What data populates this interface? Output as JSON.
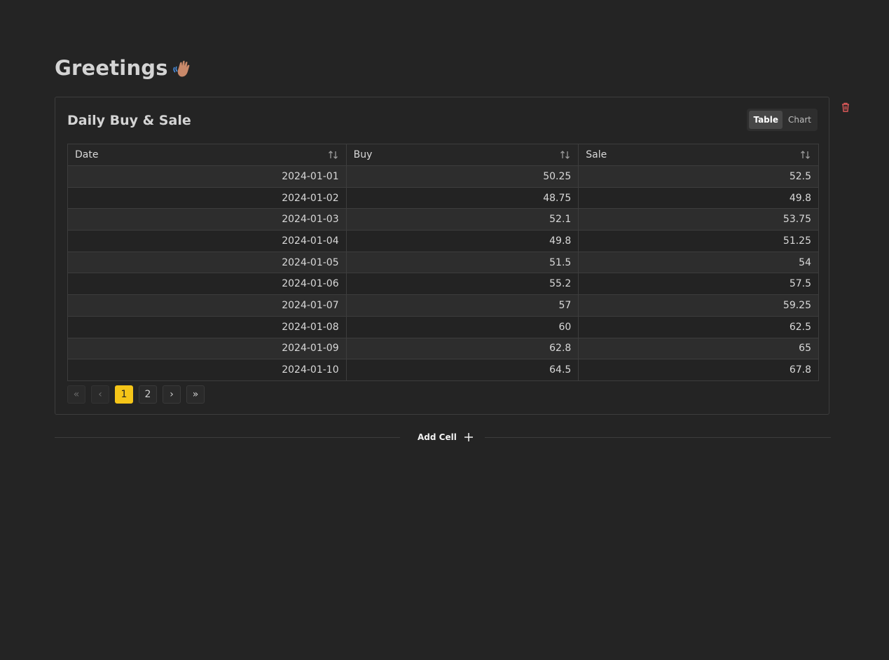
{
  "page": {
    "title": "Greetings"
  },
  "cell": {
    "title": "Daily Buy & Sale",
    "view_toggle": {
      "table_label": "Table",
      "chart_label": "Chart",
      "selected": "Table"
    },
    "table": {
      "columns": [
        "Date",
        "Buy",
        "Sale"
      ],
      "rows": [
        [
          "2024-01-01",
          "50.25",
          "52.5"
        ],
        [
          "2024-01-02",
          "48.75",
          "49.8"
        ],
        [
          "2024-01-03",
          "52.1",
          "53.75"
        ],
        [
          "2024-01-04",
          "49.8",
          "51.25"
        ],
        [
          "2024-01-05",
          "51.5",
          "54"
        ],
        [
          "2024-01-06",
          "55.2",
          "57.5"
        ],
        [
          "2024-01-07",
          "57",
          "59.25"
        ],
        [
          "2024-01-08",
          "60",
          "62.5"
        ],
        [
          "2024-01-09",
          "62.8",
          "65"
        ],
        [
          "2024-01-10",
          "64.5",
          "67.8"
        ]
      ]
    },
    "pagination": {
      "first": "«",
      "prev": "‹",
      "pages": [
        "1",
        "2"
      ],
      "current_page": "1",
      "next": "›",
      "last": "»"
    }
  },
  "add_cell": {
    "label": "Add Cell"
  },
  "colors": {
    "accent": "#f5c518",
    "danger": "#e05a5a",
    "background": "#242424"
  },
  "icons": {
    "sort": "sort-arrows-icon",
    "trash": "trash-icon",
    "plus": "plus-icon",
    "wave": "waving-hand-icon"
  }
}
